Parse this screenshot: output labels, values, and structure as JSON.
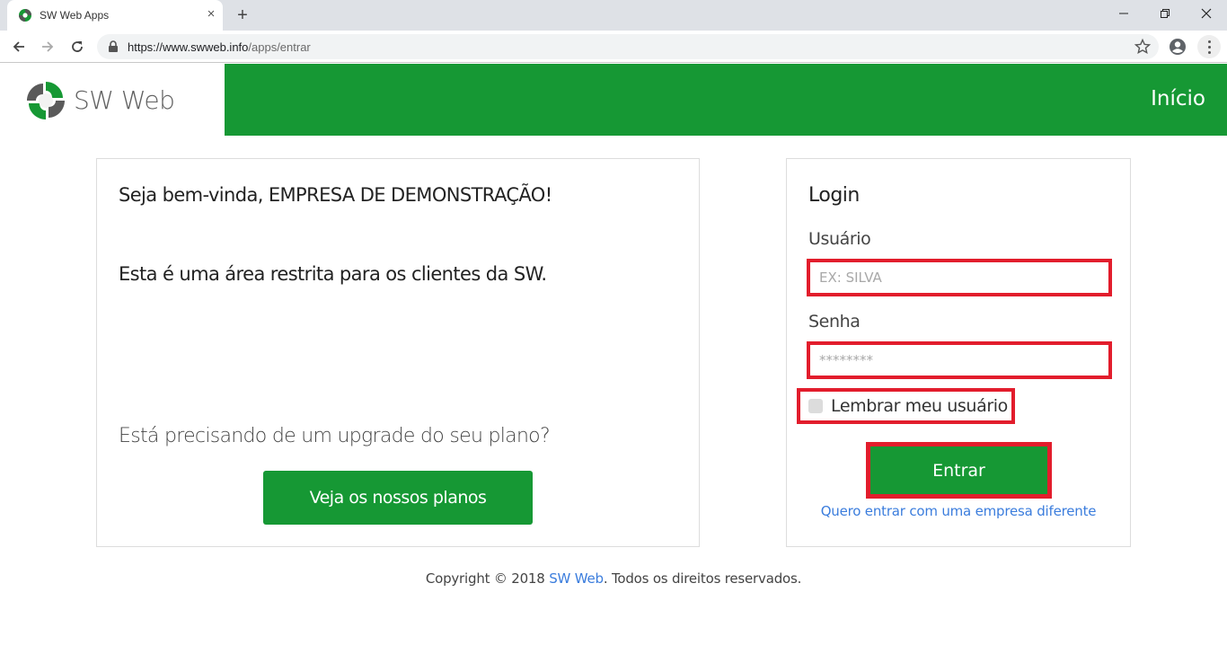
{
  "browser": {
    "tab_title": "SW Web Apps",
    "url_host": "https://www.swweb.info",
    "url_path": "/apps/entrar",
    "new_tab_label": "+",
    "tab_close_label": "×"
  },
  "header": {
    "logo_text": "SW Web",
    "nav_home": "Início",
    "brand_color": "#169834"
  },
  "welcome_panel": {
    "greeting": "Seja bem-vinda, EMPRESA DE DEMONSTRAÇÃO!",
    "restricted_notice": "Esta é uma área restrita para os clientes da SW.",
    "upgrade_question": "Está precisando de um upgrade do seu plano?",
    "plans_button": "Veja os nossos planos"
  },
  "login_panel": {
    "title": "Login",
    "username_label": "Usuário",
    "username_placeholder": "EX: SILVA",
    "username_value": "",
    "password_label": "Senha",
    "password_placeholder": "********",
    "password_value": "",
    "remember_label": "Lembrar meu usuário",
    "remember_checked": false,
    "submit_button": "Entrar",
    "different_company_link": "Quero entrar com uma empresa diferente",
    "highlight_color": "#e21d2c"
  },
  "footer": {
    "prefix": "Copyright © 2018 ",
    "link": "SW Web",
    "suffix": ". Todos os direitos reservados."
  }
}
